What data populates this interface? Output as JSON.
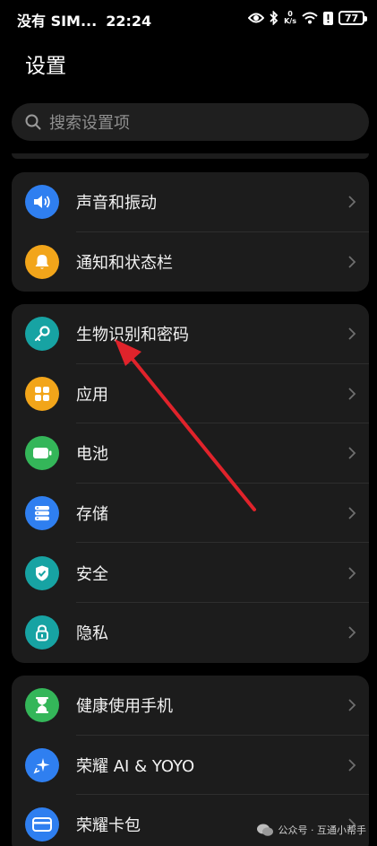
{
  "status_bar": {
    "carrier": "没有 SIM...",
    "time": "22:24",
    "net_speed_value": "0",
    "net_speed_unit": "K/s",
    "battery": "77"
  },
  "header": {
    "title": "设置"
  },
  "search": {
    "placeholder": "搜索设置项"
  },
  "groups": [
    {
      "items": [
        {
          "label": "声音和振动",
          "icon": "speaker-icon",
          "color": "#2f7ff0"
        },
        {
          "label": "通知和状态栏",
          "icon": "bell-icon",
          "color": "#f2a51a"
        }
      ]
    },
    {
      "items": [
        {
          "label": "生物识别和密码",
          "icon": "key-icon",
          "color": "#17a3a3"
        },
        {
          "label": "应用",
          "icon": "apps-grid-icon",
          "color": "#f2a51a"
        },
        {
          "label": "电池",
          "icon": "battery-icon",
          "color": "#34b659"
        },
        {
          "label": "存储",
          "icon": "storage-icon",
          "color": "#2f7ff0"
        },
        {
          "label": "安全",
          "icon": "shield-check-icon",
          "color": "#17a3a3"
        },
        {
          "label": "隐私",
          "icon": "lock-icon",
          "color": "#17a3a3"
        }
      ]
    },
    {
      "items": [
        {
          "label": "健康使用手机",
          "icon": "hourglass-icon",
          "color": "#34b659"
        },
        {
          "label": "荣耀 AI & YOYO",
          "icon": "sparkle-icon",
          "color": "#2f7ff0"
        },
        {
          "label": "荣耀卡包",
          "icon": "card-icon",
          "color": "#2f7ff0"
        }
      ]
    }
  ],
  "watermark": {
    "text": "公众号 · 互通小帮手"
  },
  "annotation": {
    "color": "#e0232b"
  }
}
